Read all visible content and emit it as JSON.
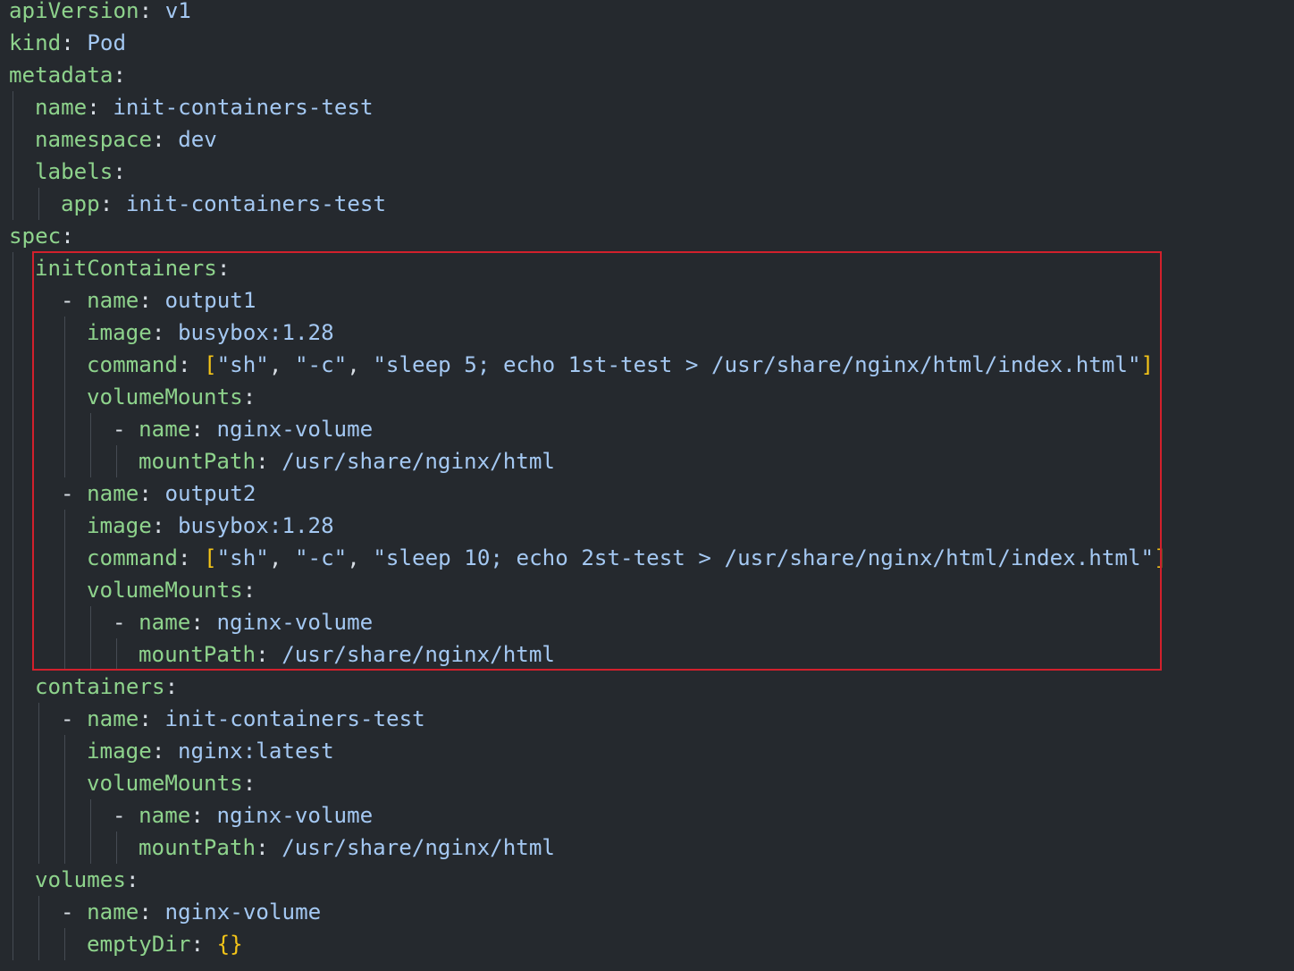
{
  "colors": {
    "background": "#25292e",
    "key": "#8ed38c",
    "value": "#a4c8f2",
    "punct": "#d7dde4",
    "bracket": "#f5c518",
    "highlight_border": "#d2202c"
  },
  "highlight": {
    "label": "initContainers section highlighted"
  },
  "lines": [
    {
      "indent": 0,
      "key": "apiVersion",
      "value": "v1"
    },
    {
      "indent": 0,
      "key": "kind",
      "value": "Pod"
    },
    {
      "indent": 0,
      "key": "metadata",
      "value": ""
    },
    {
      "indent": 1,
      "key": "name",
      "value": "init-containers-test"
    },
    {
      "indent": 1,
      "key": "namespace",
      "value": "dev"
    },
    {
      "indent": 1,
      "key": "labels",
      "value": ""
    },
    {
      "indent": 2,
      "key": "app",
      "value": "init-containers-test"
    },
    {
      "indent": 0,
      "key": "spec",
      "value": ""
    },
    {
      "indent": 1,
      "key": "initContainers",
      "value": ""
    },
    {
      "indent": 2,
      "dash": true,
      "key": "name",
      "value": "output1"
    },
    {
      "indent": 3,
      "key": "image",
      "value": "busybox:1.28"
    },
    {
      "indent": 3,
      "key": "command",
      "array": [
        "\"sh\"",
        "\"-c\"",
        "\"sleep 5; echo 1st-test > /usr/share/nginx/html/index.html\""
      ]
    },
    {
      "indent": 3,
      "key": "volumeMounts",
      "value": ""
    },
    {
      "indent": 4,
      "dash": true,
      "key": "name",
      "value": "nginx-volume"
    },
    {
      "indent": 5,
      "key": "mountPath",
      "value": "/usr/share/nginx/html"
    },
    {
      "indent": 2,
      "dash": true,
      "key": "name",
      "value": "output2"
    },
    {
      "indent": 3,
      "key": "image",
      "value": "busybox:1.28"
    },
    {
      "indent": 3,
      "key": "command",
      "array": [
        "\"sh\"",
        "\"-c\"",
        "\"sleep 10; echo 2st-test > /usr/share/nginx/html/index.html\""
      ]
    },
    {
      "indent": 3,
      "key": "volumeMounts",
      "value": ""
    },
    {
      "indent": 4,
      "dash": true,
      "key": "name",
      "value": "nginx-volume"
    },
    {
      "indent": 5,
      "key": "mountPath",
      "value": "/usr/share/nginx/html"
    },
    {
      "indent": 1,
      "key": "containers",
      "value": ""
    },
    {
      "indent": 2,
      "dash": true,
      "key": "name",
      "value": "init-containers-test"
    },
    {
      "indent": 3,
      "key": "image",
      "value": "nginx:latest"
    },
    {
      "indent": 3,
      "key": "volumeMounts",
      "value": ""
    },
    {
      "indent": 4,
      "dash": true,
      "key": "name",
      "value": "nginx-volume"
    },
    {
      "indent": 5,
      "key": "mountPath",
      "value": "/usr/share/nginx/html"
    },
    {
      "indent": 1,
      "key": "volumes",
      "value": ""
    },
    {
      "indent": 2,
      "dash": true,
      "key": "name",
      "value": "nginx-volume"
    },
    {
      "indent": 3,
      "key": "emptyDir",
      "braces": "{}"
    }
  ]
}
